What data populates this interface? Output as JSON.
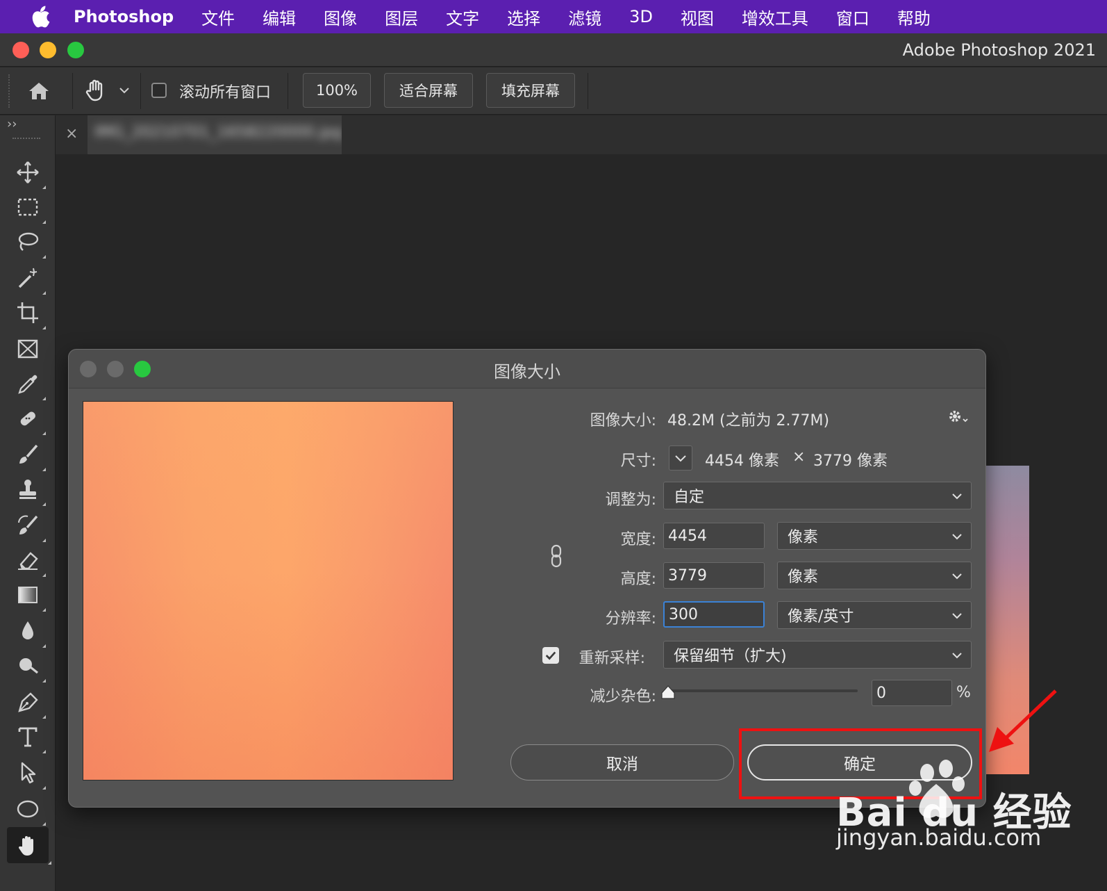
{
  "menubar": {
    "app_name": "Photoshop",
    "items": [
      "文件",
      "编辑",
      "图像",
      "图层",
      "文字",
      "选择",
      "滤镜",
      "3D",
      "视图",
      "增效工具",
      "窗口",
      "帮助"
    ]
  },
  "window": {
    "title": "Adobe Photoshop 2021"
  },
  "options_bar": {
    "scroll_all_windows_label": "滚动所有窗口",
    "scroll_all_windows_checked": false,
    "zoom_100_label": "100%",
    "fit_screen_label": "适合屏幕",
    "fill_screen_label": "填充屏幕"
  },
  "tabs": {
    "close_glyph": "×",
    "document_title": "IMG_20210701_1658220000.jpg"
  },
  "toolbar": {
    "expand_glyph": "››",
    "tools": [
      "move-icon",
      "marquee-icon",
      "lasso-icon",
      "magic-wand-icon",
      "crop-icon",
      "frame-icon",
      "eyedropper-icon",
      "healing-brush-icon",
      "brush-icon",
      "stamp-icon",
      "history-brush-icon",
      "eraser-icon",
      "gradient-icon",
      "blur-icon",
      "dodge-icon",
      "pen-icon",
      "type-icon",
      "path-select-icon",
      "ellipse-icon",
      "hand-icon"
    ],
    "active_tool": "hand-icon"
  },
  "dialog": {
    "title": "图像大小",
    "image_size_label": "图像大小:",
    "image_size_value": "48.2M (之前为 2.77M)",
    "dimensions_label": "尺寸:",
    "dimensions_width": "4454 像素",
    "dimensions_times": "×",
    "dimensions_height": "3779 像素",
    "fit_to_label": "调整为:",
    "fit_to_value": "自定",
    "width_label": "宽度:",
    "width_value": "4454",
    "width_unit": "像素",
    "height_label": "高度:",
    "height_value": "3779",
    "height_unit": "像素",
    "resolution_label": "分辨率:",
    "resolution_value": "300",
    "resolution_unit": "像素/英寸",
    "resample_label": "重新采样:",
    "resample_checked": true,
    "resample_value": "保留细节（扩大)",
    "reduce_noise_label": "减少杂色:",
    "reduce_noise_value": "0",
    "reduce_noise_percent": "%",
    "cancel_label": "取消",
    "ok_label": "确定"
  },
  "watermark": {
    "logo": "Bai du 经验",
    "url": "jingyan.baidu.com"
  },
  "colors": {
    "menubar": "#5b1fb0",
    "annotation_red": "#ee1111",
    "focus_blue": "#3b82d6"
  }
}
